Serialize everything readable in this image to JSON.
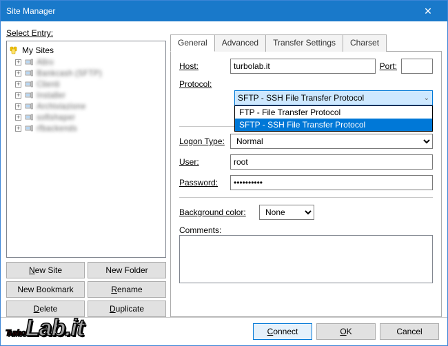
{
  "window": {
    "title": "Site Manager",
    "close_glyph": "✕"
  },
  "left": {
    "select_label": "Select Entry:",
    "root_label": "My Sites",
    "items": [
      "Altro",
      "Bankcash (SFTP)",
      "Clienti",
      "Installer",
      "Archiviazione",
      "softshaper",
      "rfbackends"
    ],
    "buttons": {
      "new_site_prefix": "N",
      "new_site_rest": "ew Site",
      "new_folder": "New Folder",
      "new_bookmark": "New Bookmark",
      "rename_prefix": "R",
      "rename_rest": "ename",
      "delete_prefix": "D",
      "delete_rest": "elete",
      "duplicate_prefix": "D",
      "duplicate_rest": "uplicate"
    }
  },
  "tabs": [
    "General",
    "Advanced",
    "Transfer Settings",
    "Charset"
  ],
  "fields": {
    "host_label": "Host:",
    "host_value": "turbolab.it",
    "port_label": "Port:",
    "port_value": "",
    "protocol_label": "Protocol:",
    "protocol_selected": "SFTP - SSH File Transfer Protocol",
    "protocol_options": [
      "FTP - File Transfer Protocol",
      "SFTP - SSH File Transfer Protocol"
    ],
    "logon_label": "Logon Type:",
    "logon_value": "Normal",
    "user_label": "User:",
    "user_value": "root",
    "password_label": "Password:",
    "password_value": "••••••••••",
    "bgcolor_label": "Background color:",
    "bgcolor_value": "None",
    "comments_label": "Comments:",
    "comments_value": ""
  },
  "bottom": {
    "connect_prefix": "C",
    "connect_rest": "onnect",
    "ok_prefix": "O",
    "ok_rest": "K",
    "cancel": "Cancel"
  },
  "watermark": {
    "part1": "Turbo",
    "part2": "Lab.it"
  },
  "icons": {
    "chevron_down": "⌄"
  }
}
